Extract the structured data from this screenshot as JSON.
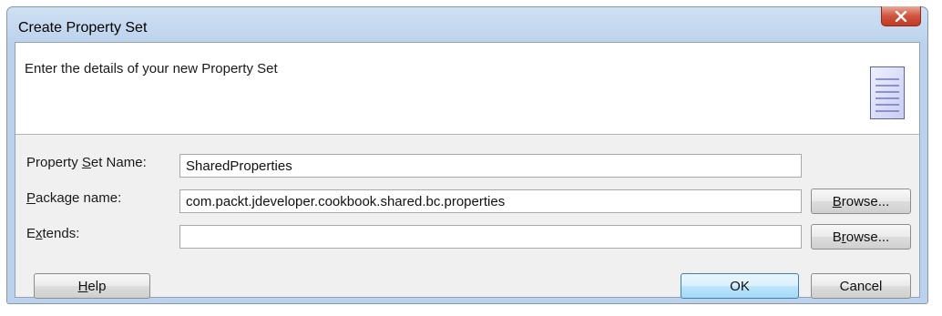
{
  "window": {
    "title": "Create Property Set",
    "close_glyph": "x"
  },
  "header": {
    "text": "Enter the details of your new Property Set",
    "icon": "document-lines-icon"
  },
  "form": {
    "property_set_name": {
      "label_pre": "Property ",
      "label_mnemonic": "S",
      "label_post": "et Name:",
      "value": "SharedProperties"
    },
    "package_name": {
      "label_pre": "",
      "label_mnemonic": "P",
      "label_post": "ackage name:",
      "value": "com.packt.jdeveloper.cookbook.shared.bc.properties"
    },
    "extends": {
      "label_pre": "E",
      "label_mnemonic": "x",
      "label_post": "tends:",
      "value": ""
    }
  },
  "buttons": {
    "browse_package": {
      "mnemonic": "B",
      "rest": "rowse..."
    },
    "browse_extends": {
      "pre": "B",
      "mnemonic": "r",
      "rest": "owse..."
    },
    "help": {
      "mnemonic": "H",
      "rest": "elp"
    },
    "ok": "OK",
    "cancel": "Cancel"
  },
  "colors": {
    "title_bar": "#bcd2ec",
    "close_button": "#c8452f",
    "dialog_bg": "#f0f0f0",
    "default_button": "#bee6fd"
  }
}
